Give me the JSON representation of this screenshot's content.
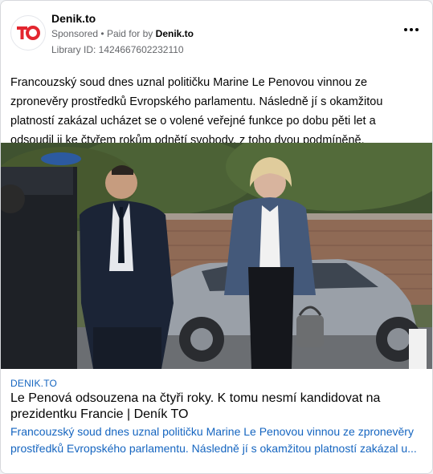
{
  "post": {
    "page_name": "Denik.to",
    "sponsored": "Sponsored",
    "separator": "•",
    "paid_for_by_label": "Paid for by",
    "paid_for_by_name": "Denik.to",
    "library_id": "Library ID: 1424667602232110",
    "more_icon": "more-options-icon",
    "logo_text": "TO",
    "body": "Francouzský soud dnes uznal političku Marine Le Penovou vinnou ze zpronevěry prostředků Evropského parlamentu. Následně jí s okamžitou platností zakázal ucházet se o volené veřejné funkce po dobu pěti let a odsoudil ji ke čtyřem rokům odnětí svobody, z toho dvou podmíněně."
  },
  "link": {
    "domain": "DENIK.TO",
    "title": "Le Penová odsouzena na čtyři roky. K tomu nesmí kandidovat na prezidentku Francie | Deník TO",
    "description_line1": "Francouzský soud dnes uznal političku Marine Le Penovou vinnou ze zpronevěry",
    "description_line2": "prostředků Evropského parlamentu. Následně jí s okamžitou platností zakázal u..."
  },
  "colors": {
    "brand_red": "#e3262f",
    "link_blue": "#1565c0",
    "text_gray": "#65676b"
  }
}
